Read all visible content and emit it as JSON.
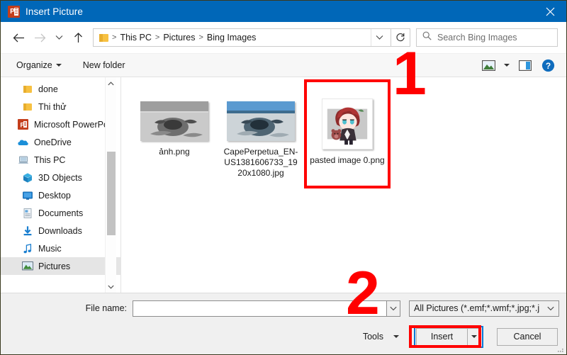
{
  "window": {
    "title": "Insert Picture",
    "app_icon": "powerpoint-icon",
    "close_label": "✕"
  },
  "nav": {
    "back_icon": "arrow-left-icon",
    "forward_icon": "arrow-right-icon",
    "recent_icon": "chevron-down-icon",
    "up_icon": "arrow-up-icon",
    "breadcrumbs": [
      "This PC",
      "Pictures",
      "Bing Images"
    ],
    "separator": ">",
    "refresh_icon": "refresh-icon",
    "dropdown_icon": "chevron-down-icon"
  },
  "search": {
    "placeholder": "Search Bing Images",
    "icon": "search-icon"
  },
  "commandbar": {
    "organize_label": "Organize",
    "new_folder_label": "New folder",
    "view_icon": "picture-view-icon",
    "view_caret_icon": "caret-down-icon",
    "preview_pane_icon": "preview-pane-icon",
    "help_icon": "help-icon"
  },
  "sidebar": {
    "items": [
      {
        "label": "done",
        "icon": "folder-icon",
        "indent": 2,
        "selected": false
      },
      {
        "label": "Thi thử",
        "icon": "folder-icon",
        "indent": 2,
        "selected": false
      },
      {
        "label": "Microsoft PowerPo",
        "icon": "powerpoint-icon",
        "indent": 1,
        "selected": false
      },
      {
        "label": "OneDrive",
        "icon": "onedrive-icon",
        "indent": 1,
        "selected": false
      },
      {
        "label": "This PC",
        "icon": "this-pc-icon",
        "indent": 1,
        "selected": false
      },
      {
        "label": "3D Objects",
        "icon": "3d-objects-icon",
        "indent": 2,
        "selected": false
      },
      {
        "label": "Desktop",
        "icon": "desktop-icon",
        "indent": 2,
        "selected": false
      },
      {
        "label": "Documents",
        "icon": "documents-icon",
        "indent": 2,
        "selected": false
      },
      {
        "label": "Downloads",
        "icon": "downloads-icon",
        "indent": 2,
        "selected": false
      },
      {
        "label": "Music",
        "icon": "music-icon",
        "indent": 2,
        "selected": false
      },
      {
        "label": "Pictures",
        "icon": "pictures-icon",
        "indent": 2,
        "selected": true
      }
    ],
    "scroll_up_icon": "chevron-up-icon",
    "scroll_down_icon": "chevron-down-icon"
  },
  "files": [
    {
      "name": "ảnh.png",
      "thumb": "grayscale-ocean-thumbnail",
      "selected": false
    },
    {
      "name": "CapePerpetua_EN-US1381606733_1920x1080.jpg",
      "thumb": "color-ocean-thumbnail",
      "selected": false
    },
    {
      "name": "pasted image 0.png",
      "thumb": "anime-chibi-thumbnail",
      "selected": true
    }
  ],
  "bottom": {
    "file_name_label": "File name:",
    "file_name_value": "",
    "file_name_caret_icon": "chevron-down-icon",
    "filter_value": "All Pictures (*.emf;*.wmf;*.jpg;*.j",
    "filter_caret_icon": "chevron-down-icon",
    "tools_label": "Tools",
    "tools_caret_icon": "caret-down-icon",
    "insert_label": "Insert",
    "insert_caret_icon": "caret-down-icon",
    "cancel_label": "Cancel"
  },
  "annotations": [
    {
      "id": "1",
      "label": "1",
      "type": "step-number"
    },
    {
      "id": "2",
      "label": "2",
      "type": "step-number"
    }
  ],
  "colors": {
    "titlebar": "#0067b8",
    "annotation_red": "#ff0000",
    "accent_blue": "#0078d7",
    "powerpoint_red": "#c43e1c"
  }
}
